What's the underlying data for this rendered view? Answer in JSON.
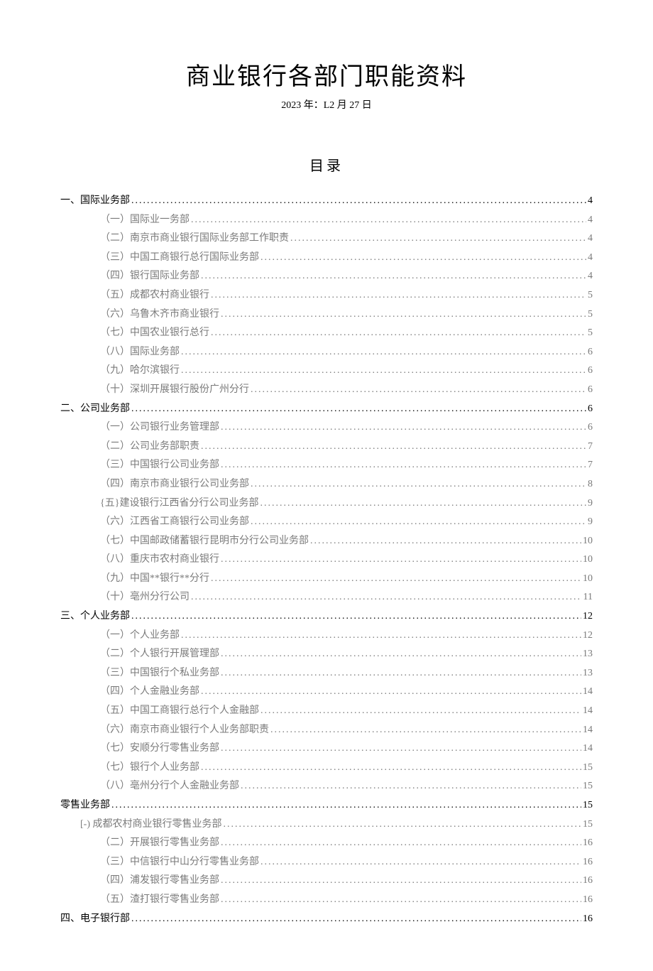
{
  "title": "商业银行各部门职能资料",
  "date": "2023 年：L2 月 27 日",
  "toc_title": "目录",
  "toc": [
    {
      "level": 1,
      "label": "一、国际业务部",
      "page": "4"
    },
    {
      "level": 2,
      "label": "（一）国际业一务部",
      "page": "4"
    },
    {
      "level": 2,
      "label": "（二）南京市商业银行国际业务部工作职责",
      "page": "4"
    },
    {
      "level": 2,
      "label": "（三）中国工商银行总行国际业务部",
      "page": "4"
    },
    {
      "level": 2,
      "label": "（四）银行国际业务部",
      "page": "4"
    },
    {
      "level": 2,
      "label": "（五）成都农村商业银行",
      "page": "5"
    },
    {
      "level": 2,
      "label": "（六）乌鲁木齐市商业银行",
      "page": "5"
    },
    {
      "level": 2,
      "label": "（七）中国农业银行总行",
      "page": "5"
    },
    {
      "level": 2,
      "label": "（八）国际业务部",
      "page": "6"
    },
    {
      "level": 2,
      "label": "（九）哈尔滨银行",
      "page": "6"
    },
    {
      "level": 2,
      "label": "（十）深圳开展银行股份广州分行",
      "page": "6"
    },
    {
      "level": 1,
      "label": "二、公司业务部",
      "page": "6"
    },
    {
      "level": 2,
      "label": "（一）公司银行业务管理部",
      "page": "6"
    },
    {
      "level": 2,
      "label": "（二）公司业务部职责",
      "page": "7"
    },
    {
      "level": 2,
      "label": "（三）中国银行公司业务部",
      "page": "7"
    },
    {
      "level": 2,
      "label": "（四）南京市商业银行公司业务部",
      "page": "8"
    },
    {
      "level": 2,
      "label": "{五}建设银行江西省分行公司业务部",
      "page": "9"
    },
    {
      "level": 2,
      "label": "（六）江西省工商银行公司业务部",
      "page": "9"
    },
    {
      "level": 2,
      "label": "（七）中国邮政储蓄银行昆明市分行公司业务部",
      "page": "10"
    },
    {
      "level": 2,
      "label": "（八）重庆市农村商业银行",
      "page": "10"
    },
    {
      "level": 2,
      "label": "（九）中国**银行**分行",
      "page": "10"
    },
    {
      "level": 2,
      "label": "（十）亳州分行公司",
      "page": "11"
    },
    {
      "level": 1,
      "label": "三、个人业务部",
      "page": "12"
    },
    {
      "level": 2,
      "label": "（一）个人业务部",
      "page": "12"
    },
    {
      "level": 2,
      "label": "（二）个人银行开展管理部",
      "page": "13"
    },
    {
      "level": 2,
      "label": "（三）中国银行个私业务部",
      "page": "13"
    },
    {
      "level": 2,
      "label": "（四）个人金融业务部",
      "page": "14"
    },
    {
      "level": 2,
      "label": "（五）中国工商银行总行个人金融部",
      "page": "14"
    },
    {
      "level": 2,
      "label": "（六）南京市商业银行个人业务部职责",
      "page": "14"
    },
    {
      "level": 2,
      "label": "（七）安顺分行零售业务部",
      "page": "14"
    },
    {
      "level": 2,
      "label": "（七）银行个人业务部",
      "page": "15"
    },
    {
      "level": 2,
      "label": "（八）亳州分行个人金融业务部",
      "page": "15"
    },
    {
      "level": 1,
      "label": "零售业务部",
      "page": "15"
    },
    {
      "level": "2b",
      "label": "[-) 成都农村商业银行零售业务部",
      "page": "15"
    },
    {
      "level": 2,
      "label": "（二）开展银行零售业务部",
      "page": "16"
    },
    {
      "level": 2,
      "label": "（三）中信银行中山分行零售业务部",
      "page": "16"
    },
    {
      "level": 2,
      "label": "（四）浦发银行零售业务部",
      "page": "16"
    },
    {
      "level": 2,
      "label": "（五）渣打银行零售业务部",
      "page": "16"
    },
    {
      "level": 1,
      "label": "四、电子银行部",
      "page": "16"
    }
  ]
}
